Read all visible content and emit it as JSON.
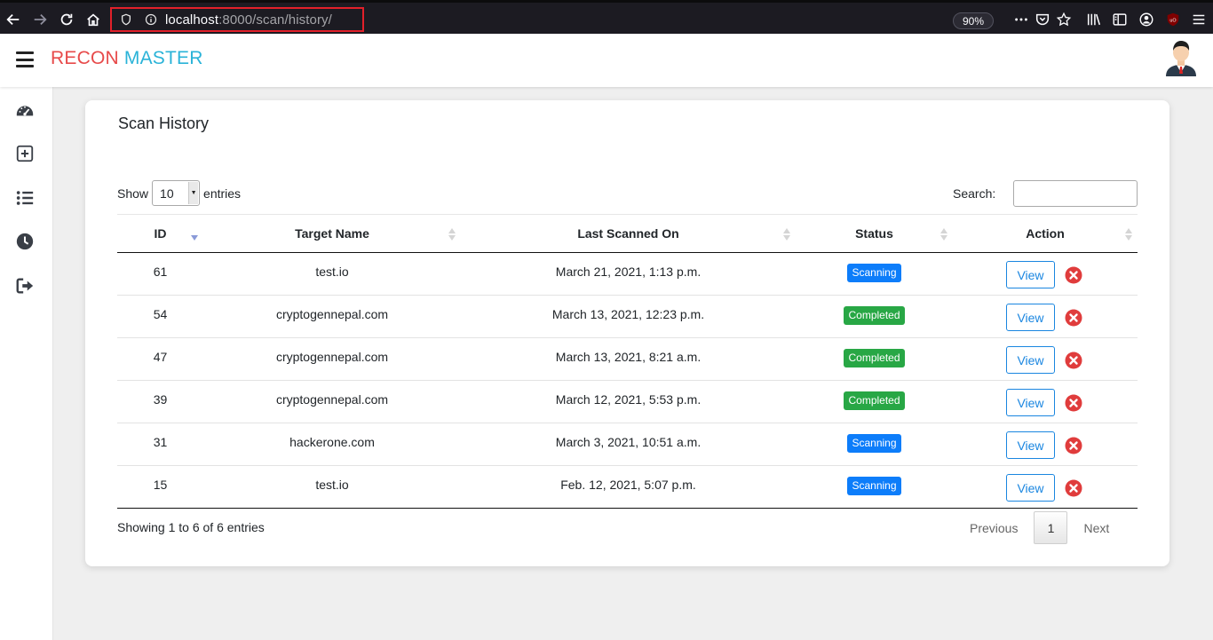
{
  "browser": {
    "url_host": "localhost",
    "url_rest": ":8000/scan/history/",
    "zoom": "90%"
  },
  "app": {
    "brand_part1": "RECON",
    "brand_part2": "MASTER",
    "colors": {
      "brand_red": "#e74a4a",
      "brand_blue": "#2ab3d8",
      "scanning": "#0d7dfa",
      "completed": "#28a745",
      "delete": "#e03c3c"
    }
  },
  "sidebar": {
    "items": [
      {
        "icon": "dashboard-gauge-icon"
      },
      {
        "icon": "add-scan-icon"
      },
      {
        "icon": "list-icon"
      },
      {
        "icon": "clock-history-icon"
      },
      {
        "icon": "logout-icon"
      }
    ]
  },
  "page": {
    "title": "Scan History",
    "show_label": "Show",
    "entries_value": "10",
    "entries_label": "entries",
    "search_label": "Search:",
    "search_value": ""
  },
  "table": {
    "columns": [
      "ID",
      "Target Name",
      "Last Scanned On",
      "Status",
      "Action"
    ],
    "rows": [
      {
        "id": "61",
        "target": "test.io",
        "date": "March 21, 2021, 1:13 p.m.",
        "status": "Scanning",
        "action": "View"
      },
      {
        "id": "54",
        "target": "cryptogennepal.com",
        "date": "March 13, 2021, 12:23 p.m.",
        "status": "Completed",
        "action": "View"
      },
      {
        "id": "47",
        "target": "cryptogennepal.com",
        "date": "March 13, 2021, 8:21 a.m.",
        "status": "Completed",
        "action": "View"
      },
      {
        "id": "39",
        "target": "cryptogennepal.com",
        "date": "March 12, 2021, 5:53 p.m.",
        "status": "Completed",
        "action": "View"
      },
      {
        "id": "31",
        "target": "hackerone.com",
        "date": "March 3, 2021, 10:51 a.m.",
        "status": "Scanning",
        "action": "View"
      },
      {
        "id": "15",
        "target": "test.io",
        "date": "Feb. 12, 2021, 5:07 p.m.",
        "status": "Scanning",
        "action": "View"
      }
    ]
  },
  "footer": {
    "info": "Showing 1 to 6 of 6 entries",
    "previous": "Previous",
    "page": "1",
    "next": "Next"
  }
}
